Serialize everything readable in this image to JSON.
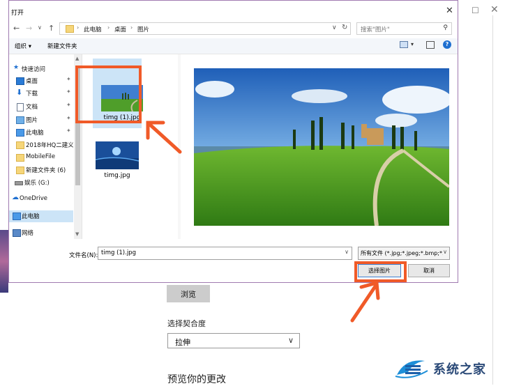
{
  "dialog": {
    "title": "打开",
    "close_glyph": "✕",
    "nav": {
      "back": "←",
      "forward": "→",
      "recent": "∨",
      "up": "↑"
    },
    "breadcrumb": [
      "此电脑",
      "桌面",
      "图片"
    ],
    "crumb_sep": "›",
    "addr_chev": "∨",
    "refresh": "↻",
    "search_placeholder": "搜索\"图片\"",
    "search_icon": "⚲",
    "toolbar": {
      "organize": "组织 ▾",
      "new_folder": "新建文件夹",
      "help": "?"
    },
    "nav_pane": [
      {
        "label": "快速访问",
        "icon": "star-icon",
        "pinned": false
      },
      {
        "label": "桌面",
        "icon": "desktop-icon",
        "pinned": true
      },
      {
        "label": "下载",
        "icon": "download-icon",
        "pinned": true
      },
      {
        "label": "文档",
        "icon": "document-icon",
        "pinned": true
      },
      {
        "label": "图片",
        "icon": "pictures-icon",
        "pinned": true
      },
      {
        "label": "此电脑",
        "icon": "computer-icon",
        "pinned": true
      },
      {
        "label": "2018年HQ二建义",
        "icon": "folder-icon",
        "pinned": false
      },
      {
        "label": "MobileFile",
        "icon": "folder-icon",
        "pinned": false
      },
      {
        "label": "新建文件夹 (6)",
        "icon": "folder-icon",
        "pinned": false
      },
      {
        "label": "娱乐 (G:)",
        "icon": "drive-icon",
        "pinned": false
      },
      {
        "label": "OneDrive",
        "icon": "cloud-icon",
        "pinned": false
      },
      {
        "label": "此电脑",
        "icon": "computer-icon",
        "pinned": false,
        "selected": true
      },
      {
        "label": "网络",
        "icon": "network-icon",
        "pinned": false
      }
    ],
    "pin_glyph": "📌",
    "files": [
      {
        "name": "timg (1).jpg",
        "selected": true
      },
      {
        "name": "timg.jpg",
        "selected": false
      }
    ],
    "filename_label": "文件名(N):",
    "filename_value": "timg (1).jpg",
    "filetype_value": "所有文件 (*.jpg;*.jpeg;*.bmp;*.",
    "open_label": "选择图片",
    "cancel_label": "取消",
    "chev": "∨"
  },
  "background": {
    "min_glyph": "☐",
    "close_glyph": "✕",
    "browse_label": "浏览",
    "fit_label": "选择契合度",
    "fit_value": "拉伸",
    "fit_chev": "∨",
    "preview_heading": "预览你的更改"
  },
  "watermark": {
    "text": "系统之家"
  },
  "colors": {
    "highlight": "#f05a28",
    "selection": "#cce4f7",
    "dialog_border": "#a07ab0"
  }
}
